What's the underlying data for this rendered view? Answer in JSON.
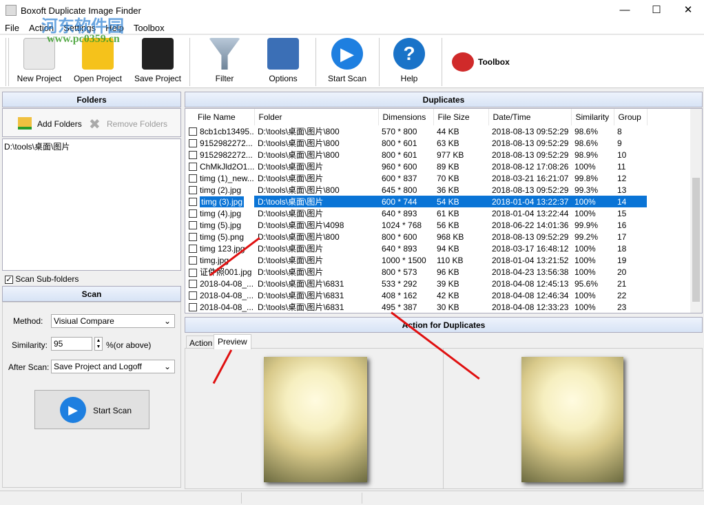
{
  "app": {
    "title": "Boxoft Duplicate Image Finder",
    "watermark": "河东软件园 www.pc0359.cn"
  },
  "menu": [
    "File",
    "Action",
    "Settings",
    "Help",
    "Toolbox"
  ],
  "toolbar": [
    {
      "label": "New Project",
      "icon": "new-project-icon",
      "color": "#e8e8e8"
    },
    {
      "label": "Open Project",
      "icon": "folder-open-icon",
      "color": "#f5c21b"
    },
    {
      "label": "Save Project",
      "icon": "floppy-disk-icon",
      "color": "#222222"
    },
    {
      "label": "Filter",
      "icon": "funnel-icon",
      "color": "#8fa3b8"
    },
    {
      "label": "Options",
      "icon": "options-icon",
      "color": "#3b6fb6"
    },
    {
      "label": "Start Scan",
      "icon": "play-icon",
      "color": "#1e7fe0"
    },
    {
      "label": "Help",
      "icon": "help-icon",
      "color": "#1a73c8"
    }
  ],
  "toolbox_label": "Toolbox",
  "folders": {
    "header": "Folders",
    "add": "Add Folders",
    "remove": "Remove Folders",
    "items": [
      "D:\\tools\\桌面\\图片"
    ],
    "scan_sub": "Scan Sub-folders",
    "scan_sub_checked": true
  },
  "scan": {
    "header": "Scan",
    "method_label": "Method:",
    "method": "Visiual Compare",
    "similarity_label": "Similarity:",
    "similarity": "95",
    "similarity_suffix": "%(or above)",
    "after_label": "After Scan:",
    "after": "Save Project and Logoff",
    "start": "Start Scan"
  },
  "duplicates": {
    "header": "Duplicates",
    "columns": [
      "File Name",
      "Folder",
      "Dimensions",
      "File Size",
      "Date/Time",
      "Similarity",
      "Group"
    ],
    "selected_row": 6,
    "rows": [
      [
        "8cb1cb13495...",
        "D:\\tools\\桌面\\图片\\800",
        "570 * 800",
        "44 KB",
        "2018-08-13 09:52:29",
        "98.6%",
        "8"
      ],
      [
        "9152982272...",
        "D:\\tools\\桌面\\图片\\800",
        "800 * 601",
        "63 KB",
        "2018-08-13 09:52:29",
        "98.6%",
        "9"
      ],
      [
        "9152982272...",
        "D:\\tools\\桌面\\图片\\800",
        "800 * 601",
        "977 KB",
        "2018-08-13 09:52:29",
        "98.9%",
        "10"
      ],
      [
        "ChMkJld2O1...",
        "D:\\tools\\桌面\\图片",
        "960 * 600",
        "89 KB",
        "2018-08-12 17:08:26",
        "100%",
        "11"
      ],
      [
        "timg (1)_new...",
        "D:\\tools\\桌面\\图片",
        "600 * 837",
        "70 KB",
        "2018-03-21 16:21:07",
        "99.8%",
        "12"
      ],
      [
        "timg (2).jpg",
        "D:\\tools\\桌面\\图片\\800",
        "645 * 800",
        "36 KB",
        "2018-08-13 09:52:29",
        "99.3%",
        "13"
      ],
      [
        "timg (3).jpg",
        "D:\\tools\\桌面\\图片",
        "600 * 744",
        "54 KB",
        "2018-01-04 13:22:37",
        "100%",
        "14"
      ],
      [
        "timg (4).jpg",
        "D:\\tools\\桌面\\图片",
        "640 * 893",
        "61 KB",
        "2018-01-04 13:22:44",
        "100%",
        "15"
      ],
      [
        "timg (5).jpg",
        "D:\\tools\\桌面\\图片\\4098",
        "1024 * 768",
        "56 KB",
        "2018-06-22 14:01:36",
        "99.9%",
        "16"
      ],
      [
        "timg (5).png",
        "D:\\tools\\桌面\\图片\\800",
        "800 * 600",
        "968 KB",
        "2018-08-13 09:52:29",
        "99.2%",
        "17"
      ],
      [
        "timg 123.jpg",
        "D:\\tools\\桌面\\图片",
        "640 * 893",
        "94 KB",
        "2018-03-17 16:48:12",
        "100%",
        "18"
      ],
      [
        "timg.jpg",
        "D:\\tools\\桌面\\图片",
        "1000 * 1500",
        "110 KB",
        "2018-01-04 13:21:52",
        "100%",
        "19"
      ],
      [
        "证件照001.jpg",
        "D:\\tools\\桌面\\图片",
        "800 * 573",
        "96 KB",
        "2018-04-23 13:56:38",
        "100%",
        "20"
      ],
      [
        "2018-04-08_...",
        "D:\\tools\\桌面\\图片\\6831",
        "533 * 292",
        "39 KB",
        "2018-04-08 12:45:13",
        "95.6%",
        "21"
      ],
      [
        "2018-04-08_...",
        "D:\\tools\\桌面\\图片\\6831",
        "408 * 162",
        "42 KB",
        "2018-04-08 12:46:34",
        "100%",
        "22"
      ],
      [
        "2018-04-08_...",
        "D:\\tools\\桌面\\图片\\6831",
        "495 * 387",
        "30 KB",
        "2018-04-08 12:33:23",
        "100%",
        "23"
      ]
    ]
  },
  "action": {
    "header": "Action for Duplicates",
    "tabs": [
      "Action",
      "Preview"
    ],
    "active_tab": "Preview"
  },
  "colors": {
    "selection": "#0a74d6",
    "annotation_arrow": "#e01010"
  }
}
